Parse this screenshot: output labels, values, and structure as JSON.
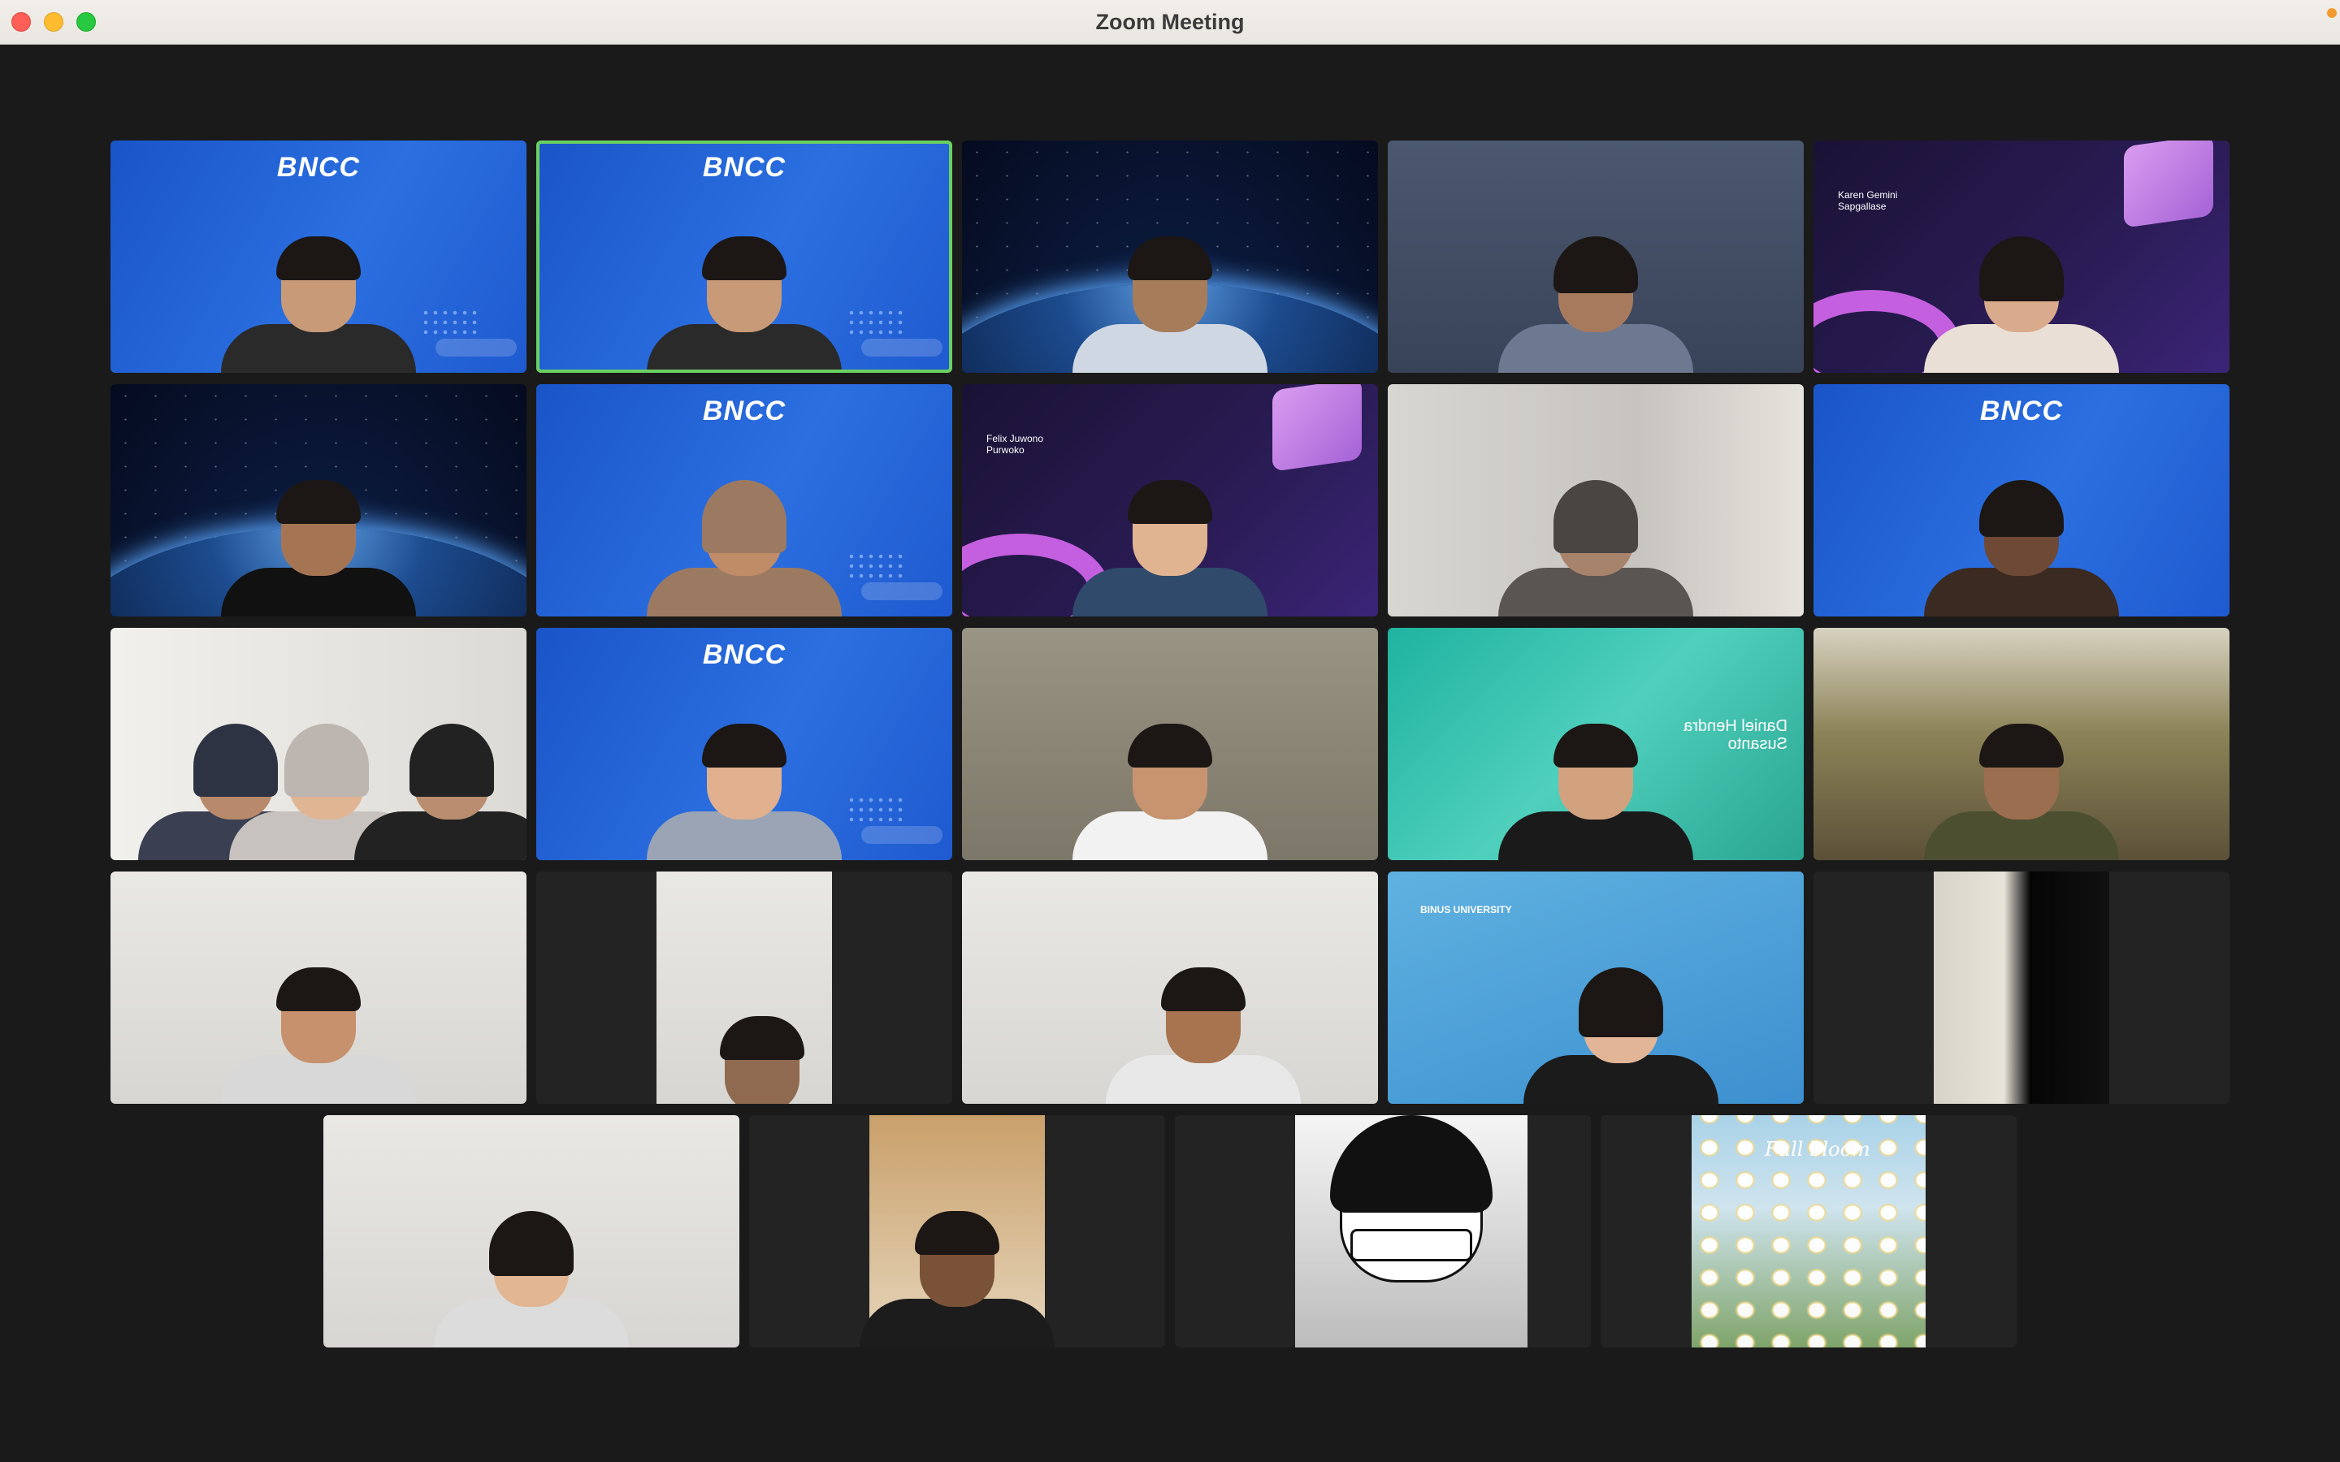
{
  "window": {
    "title": "Zoom Meeting"
  },
  "tiles": [
    {
      "id": 1,
      "background": "bncc",
      "logo_text": "BNCC"
    },
    {
      "id": 2,
      "background": "bncc",
      "logo_text": "BNCC",
      "active_speaker": true
    },
    {
      "id": 3,
      "background": "space"
    },
    {
      "id": 4,
      "background": "room"
    },
    {
      "id": 5,
      "background": "purple",
      "name_tag": "Karen Gemini Sapgallase"
    },
    {
      "id": 6,
      "background": "space"
    },
    {
      "id": 7,
      "background": "bncc",
      "logo_text": "BNCC"
    },
    {
      "id": 8,
      "background": "purple",
      "name_tag": "Felix Juwono Purwoko"
    },
    {
      "id": 9,
      "background": "wall"
    },
    {
      "id": 10,
      "background": "bncc",
      "logo_text": "BNCC"
    },
    {
      "id": 11,
      "background": "white"
    },
    {
      "id": 12,
      "background": "bncc",
      "logo_text": "BNCC"
    },
    {
      "id": 13,
      "background": "beige"
    },
    {
      "id": 14,
      "background": "teal",
      "name_tag": "Daniel Hendra Susanto"
    },
    {
      "id": 15,
      "background": "trees"
    },
    {
      "id": 16,
      "background": "light"
    },
    {
      "id": 17,
      "background": "dark-portrait"
    },
    {
      "id": 18,
      "background": "light"
    },
    {
      "id": 19,
      "background": "sky",
      "name_tag": "BINUS UNIVERSITY"
    },
    {
      "id": 20,
      "background": "dark-portrait"
    },
    {
      "id": 21,
      "background": "light"
    },
    {
      "id": 22,
      "background": "dark-portrait"
    },
    {
      "id": 23,
      "background": "manga-avatar"
    },
    {
      "id": 24,
      "background": "flowers",
      "caption": "Full bloom"
    }
  ],
  "colors": {
    "active_speaker_border": "#6ad160",
    "stage_background": "#1a1a1a",
    "titlebar": "#ece9e4"
  }
}
